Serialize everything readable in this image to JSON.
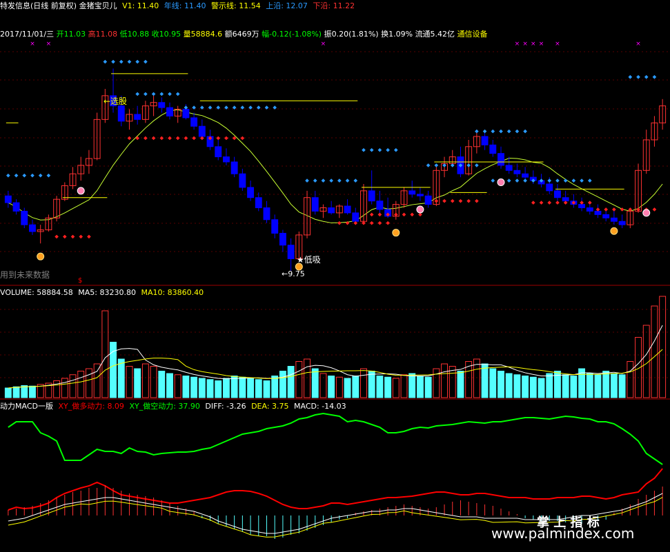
{
  "header": {
    "title": "特发信息(日线 前复权) 金猪宝贝儿",
    "v1_label": "V1: 11.40",
    "year_line": "年线: 11.40",
    "warn_line": "警示线: 11.54",
    "upper": "上沿: 12.07",
    "lower": "下沿: 11.22"
  },
  "info": {
    "date": "2017/11/01/三",
    "open": "开11.03",
    "high": "高11.08",
    "low": "低10.88",
    "close": "收10.95",
    "vol": "量58884.6",
    "amount": "额6469万",
    "change": "幅-0.12(-1.08%)",
    "amp": "振0.20(1.81%)",
    "turnover": "换1.09%",
    "float": "流通5.42亿",
    "sector": "通信设备"
  },
  "annotations": {
    "select": "←选股",
    "buy_low": "★低吸",
    "future_data": "用到未来数据",
    "low_price": "←9.75",
    "dollar": "$"
  },
  "volume_header": {
    "volume": "VOLUME: 58884.58",
    "ma5": "MA5: 83230.80",
    "ma10": "MA10: 83860.40"
  },
  "macd_header": {
    "name": "动力MACD一版",
    "xy_long": "XY_做多动力: 8.09",
    "xy_short": "XY_做空动力: 37.90",
    "diff": "DIFF: -3.26",
    "dea": "DEA: 3.75",
    "macd": "MACD: -14.03"
  },
  "watermark": {
    "cn": "掌 上 指 标",
    "url": "www.palmindex.com"
  },
  "colors": {
    "up": "#ff3232",
    "down": "#0000ff",
    "vol_down": "#54ffff",
    "ma_line": "#c8ff32",
    "yellow_line": "#ffff00",
    "green_line": "#00ff00",
    "red_line": "#ff0000",
    "dot_blue": "#2a9aff",
    "dot_red": "#ff2020",
    "magenta": "#ff00ff"
  },
  "chart_data": [
    {
      "type": "candlestick",
      "series": [
        {
          "name": "K线",
          "values": [
            [
              11.95,
              12.1,
              11.6,
              11.75
            ],
            [
              11.75,
              11.85,
              11.4,
              11.5
            ],
            [
              11.5,
              11.6,
              11.0,
              11.1
            ],
            [
              11.1,
              11.25,
              10.8,
              10.9
            ],
            [
              10.9,
              11.1,
              10.55,
              10.95
            ],
            [
              10.95,
              11.4,
              10.9,
              11.3
            ],
            [
              11.3,
              11.95,
              11.2,
              11.85
            ],
            [
              11.85,
              12.35,
              11.8,
              12.25
            ],
            [
              12.25,
              12.8,
              12.15,
              12.6
            ],
            [
              12.6,
              13.1,
              12.4,
              12.85
            ],
            [
              12.85,
              13.3,
              12.6,
              13.05
            ],
            [
              13.05,
              14.4,
              13.0,
              14.2
            ],
            [
              14.2,
              15.1,
              14.1,
              14.9
            ],
            [
              14.9,
              15.7,
              14.4,
              14.6
            ],
            [
              14.6,
              14.9,
              14.0,
              14.15
            ],
            [
              14.15,
              14.5,
              13.9,
              14.35
            ],
            [
              14.35,
              14.6,
              14.05,
              14.2
            ],
            [
              14.2,
              14.75,
              14.1,
              14.6
            ],
            [
              14.6,
              14.9,
              14.3,
              14.7
            ],
            [
              14.7,
              14.85,
              14.4,
              14.55
            ],
            [
              14.55,
              14.7,
              14.2,
              14.3
            ],
            [
              14.3,
              14.6,
              14.1,
              14.5
            ],
            [
              14.5,
              14.65,
              14.2,
              14.25
            ],
            [
              14.25,
              14.4,
              13.9,
              14.0
            ],
            [
              14.0,
              14.2,
              13.6,
              13.7
            ],
            [
              13.7,
              13.9,
              13.3,
              13.4
            ],
            [
              13.4,
              13.6,
              13.0,
              13.1
            ],
            [
              13.1,
              13.35,
              12.85,
              12.95
            ],
            [
              12.95,
              13.1,
              12.5,
              12.6
            ],
            [
              12.6,
              12.75,
              12.1,
              12.2
            ],
            [
              12.2,
              12.4,
              11.8,
              11.9
            ],
            [
              11.9,
              12.05,
              11.5,
              11.6
            ],
            [
              11.6,
              11.8,
              11.15,
              11.25
            ],
            [
              11.25,
              11.4,
              10.7,
              10.85
            ],
            [
              10.85,
              10.95,
              10.3,
              10.5
            ],
            [
              10.5,
              10.7,
              9.75,
              10.1
            ],
            [
              10.1,
              10.9,
              10.05,
              10.8
            ],
            [
              10.8,
              12.1,
              10.7,
              11.9
            ],
            [
              11.9,
              12.1,
              11.4,
              11.5
            ],
            [
              11.5,
              11.7,
              11.3,
              11.6
            ],
            [
              11.6,
              11.8,
              11.4,
              11.45
            ],
            [
              11.45,
              11.7,
              11.3,
              11.65
            ],
            [
              11.65,
              11.85,
              11.4,
              11.45
            ],
            [
              11.45,
              11.6,
              11.1,
              11.2
            ],
            [
              11.2,
              12.3,
              11.15,
              12.1
            ],
            [
              12.1,
              12.7,
              11.7,
              11.8
            ],
            [
              11.8,
              12.1,
              11.4,
              11.55
            ],
            [
              11.55,
              11.9,
              11.3,
              11.35
            ],
            [
              11.35,
              11.8,
              11.25,
              11.7
            ],
            [
              11.7,
              12.2,
              11.6,
              12.1
            ],
            [
              12.1,
              12.4,
              11.9,
              12.0
            ],
            [
              12.0,
              12.2,
              11.8,
              11.95
            ],
            [
              11.95,
              12.1,
              11.6,
              11.7
            ],
            [
              11.7,
              12.8,
              11.65,
              12.7
            ],
            [
              12.7,
              13.1,
              12.5,
              12.9
            ],
            [
              12.9,
              13.3,
              12.8,
              13.1
            ],
            [
              13.1,
              13.4,
              12.5,
              12.6
            ],
            [
              12.6,
              13.6,
              12.55,
              13.4
            ],
            [
              13.4,
              13.9,
              13.2,
              13.7
            ],
            [
              13.7,
              13.8,
              13.3,
              13.45
            ],
            [
              13.45,
              13.6,
              13.1,
              13.2
            ],
            [
              13.2,
              13.4,
              12.75,
              12.85
            ],
            [
              12.85,
              13.1,
              12.6,
              12.7
            ],
            [
              12.7,
              12.9,
              12.5,
              12.6
            ],
            [
              12.6,
              12.8,
              12.4,
              12.5
            ],
            [
              12.5,
              12.7,
              12.3,
              12.4
            ],
            [
              12.4,
              12.6,
              12.2,
              12.3
            ],
            [
              12.3,
              12.5,
              12.0,
              12.1
            ],
            [
              12.1,
              12.3,
              11.8,
              11.9
            ],
            [
              11.9,
              12.1,
              11.7,
              11.8
            ],
            [
              11.8,
              12.0,
              11.6,
              11.7
            ],
            [
              11.7,
              11.9,
              11.5,
              11.6
            ],
            [
              11.6,
              11.8,
              11.4,
              11.5
            ],
            [
              11.5,
              11.7,
              11.3,
              11.4
            ],
            [
              11.4,
              11.6,
              11.2,
              11.3
            ],
            [
              11.3,
              11.5,
              11.1,
              11.2
            ],
            [
              11.2,
              11.4,
              11.0,
              11.1
            ],
            [
              11.1,
              11.6,
              11.0,
              11.5
            ],
            [
              11.5,
              12.9,
              11.45,
              12.7
            ],
            [
              12.7,
              13.9,
              12.6,
              13.6
            ],
            [
              13.6,
              14.3,
              13.4,
              14.1
            ],
            [
              14.1,
              14.8,
              13.9,
              14.6
            ]
          ]
        }
      ],
      "ylim": [
        9.5,
        16.5
      ]
    },
    {
      "type": "bar",
      "series": [
        {
          "name": "VOLUME",
          "values": [
            40000,
            45000,
            50000,
            48000,
            55000,
            60000,
            70000,
            80000,
            95000,
            110000,
            120000,
            140000,
            360000,
            230000,
            160000,
            130000,
            120000,
            140000,
            130000,
            110000,
            100000,
            95000,
            90000,
            85000,
            80000,
            75000,
            70000,
            80000,
            90000,
            85000,
            80000,
            75000,
            70000,
            90000,
            110000,
            130000,
            150000,
            160000,
            120000,
            100000,
            90000,
            85000,
            80000,
            90000,
            120000,
            110000,
            90000,
            85000,
            80000,
            95000,
            100000,
            90000,
            85000,
            120000,
            140000,
            130000,
            110000,
            150000,
            160000,
            140000,
            120000,
            110000,
            100000,
            95000,
            90000,
            85000,
            80000,
            100000,
            110000,
            95000,
            90000,
            120000,
            100000,
            95000,
            110000,
            100000,
            95000,
            150000,
            250000,
            300000,
            380000,
            420000
          ]
        },
        {
          "name": "MA5",
          "values": []
        },
        {
          "name": "MA10",
          "values": []
        }
      ],
      "current": {
        "VOLUME": 58884.58,
        "MA5": 83230.8,
        "MA10": 83860.4
      }
    },
    {
      "type": "line",
      "series": [
        {
          "name": "XY_做多动力",
          "current": 8.09
        },
        {
          "name": "XY_做空动力",
          "current": 37.9
        },
        {
          "name": "DIFF",
          "current": -3.26
        },
        {
          "name": "DEA",
          "current": 3.75
        },
        {
          "name": "MACD",
          "current": -14.03
        }
      ]
    }
  ]
}
